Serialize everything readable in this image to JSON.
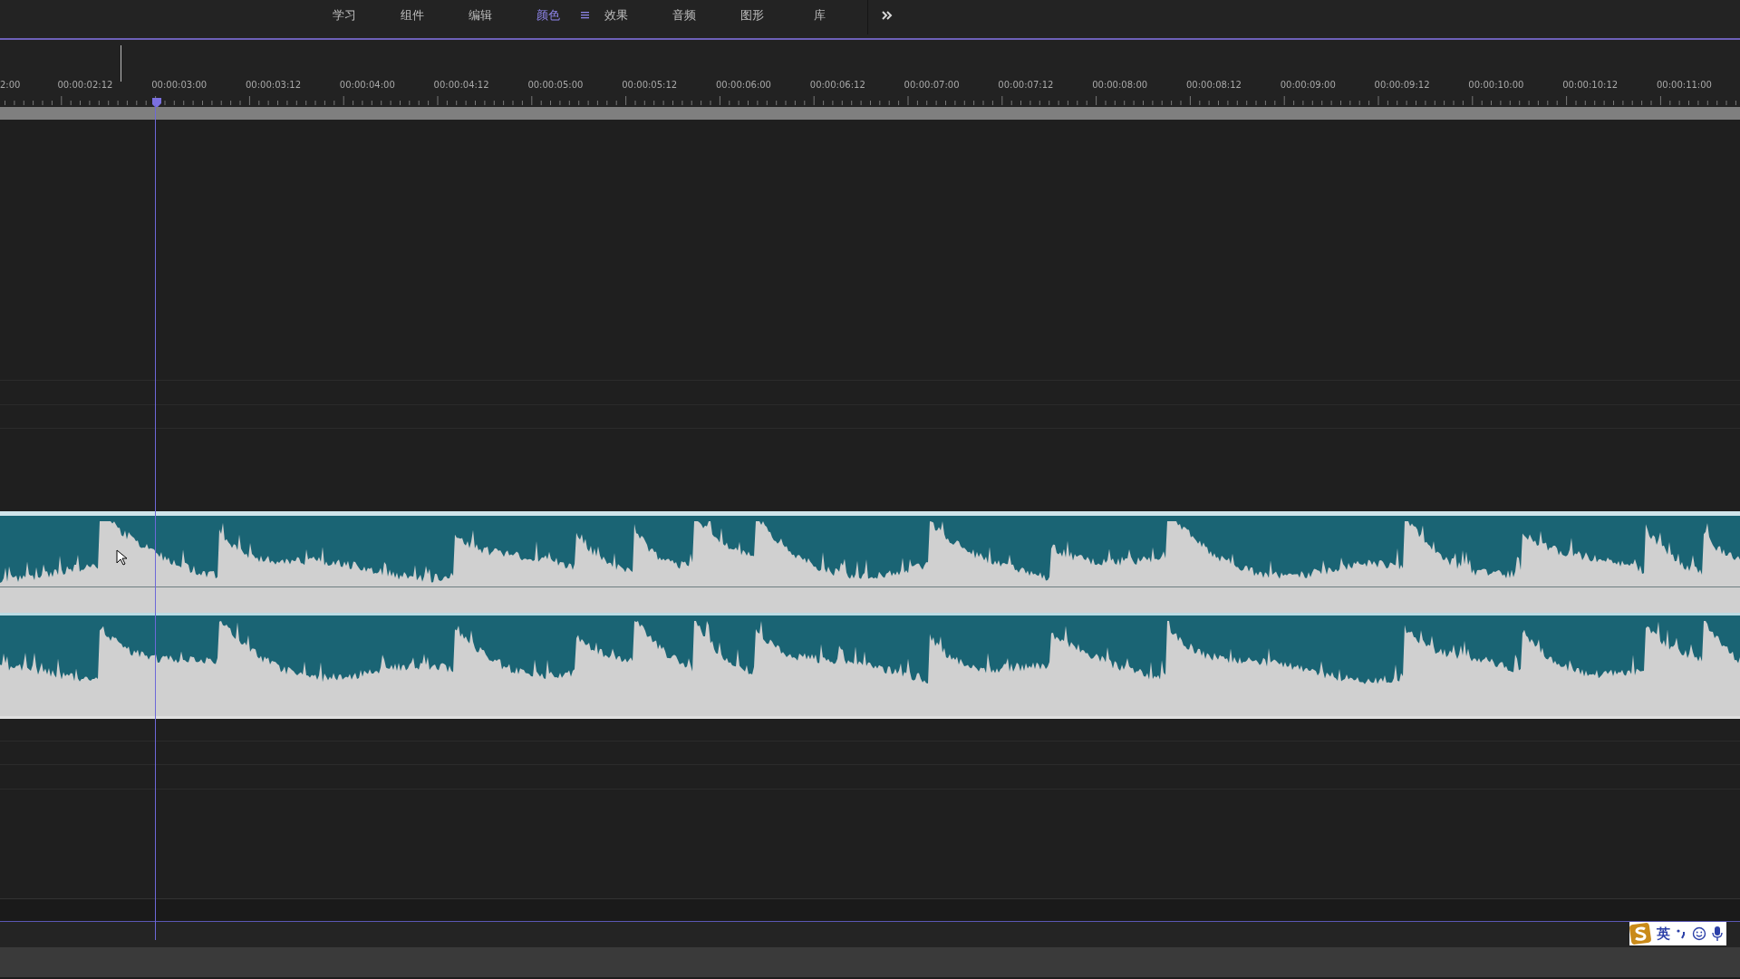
{
  "workspace_tabs": [
    {
      "label": "学习",
      "selected": false
    },
    {
      "label": "组件",
      "selected": false
    },
    {
      "label": "编辑",
      "selected": false
    },
    {
      "label": "颜色",
      "selected": true
    },
    {
      "label": "效果",
      "selected": false
    },
    {
      "label": "音频",
      "selected": false
    },
    {
      "label": "图形",
      "selected": false
    },
    {
      "label": "库",
      "selected": false
    }
  ],
  "ruler": {
    "labels": [
      "2:00",
      "00:00:02:12",
      "00:00:03:00",
      "00:00:03:12",
      "00:00:04:00",
      "00:00:04:12",
      "00:00:05:00",
      "00:00:05:12",
      "00:00:06:00",
      "00:00:06:12",
      "00:00:07:00",
      "00:00:07:12",
      "00:00:08:00",
      "00:00:08:12",
      "00:00:09:00",
      "00:00:09:12",
      "00:00:10:00",
      "00:00:10:12",
      "00:00:11:00"
    ]
  },
  "ime_toolbar": {
    "language": "英"
  }
}
